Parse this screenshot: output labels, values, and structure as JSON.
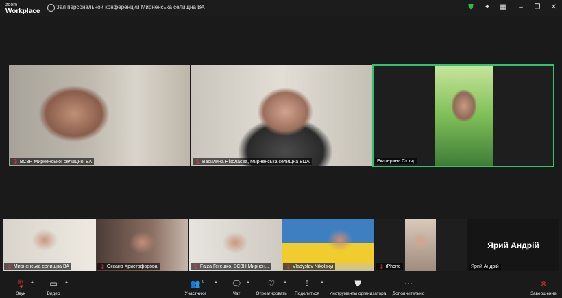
{
  "window": {
    "brand_small": "zoom",
    "brand_big": "Workplace",
    "title": "Зал персональной конференции Мирненська селищна ВА"
  },
  "titlebar_icons": [
    "shield-icon",
    "magic-wand-icon",
    "grid-icon",
    "minimize-icon",
    "maximize-icon",
    "close-icon"
  ],
  "colors": {
    "active_speaker": "#2ec46c",
    "muted_mic": "#e0383e",
    "background": "#1a1a1a"
  },
  "tiles": [
    {
      "name": "ВСЗН Мирненської селищноі  ВА",
      "muted": true
    },
    {
      "name": "Василина Ніколаєва, Мирненська селищна ВЦА",
      "muted": true
    },
    {
      "name": "Екатерина Скляр",
      "muted": false,
      "active": true
    },
    {
      "name": "Мирненська селищна ВА",
      "muted": true
    },
    {
      "name": "Оксана Христофорова",
      "muted": true
    },
    {
      "name": "Faiza Гегешко, ВСЗН Мирнен...",
      "muted": true
    },
    {
      "name": "Vladyslav Nikolskyi",
      "muted": true
    },
    {
      "name": "iPhone",
      "muted": true
    },
    {
      "name": "Ярий Андрій",
      "display_name": "Ярий Андрій",
      "muted": false
    }
  ],
  "controls": {
    "audio": "Звук",
    "video": "Видео",
    "participants": "Участники",
    "participants_count": "9",
    "chat": "Чат",
    "react": "Отреагировать",
    "share": "Поделиться",
    "host_tools": "Инструменты организатора",
    "more": "Дополнительно",
    "end": "Завершение"
  }
}
